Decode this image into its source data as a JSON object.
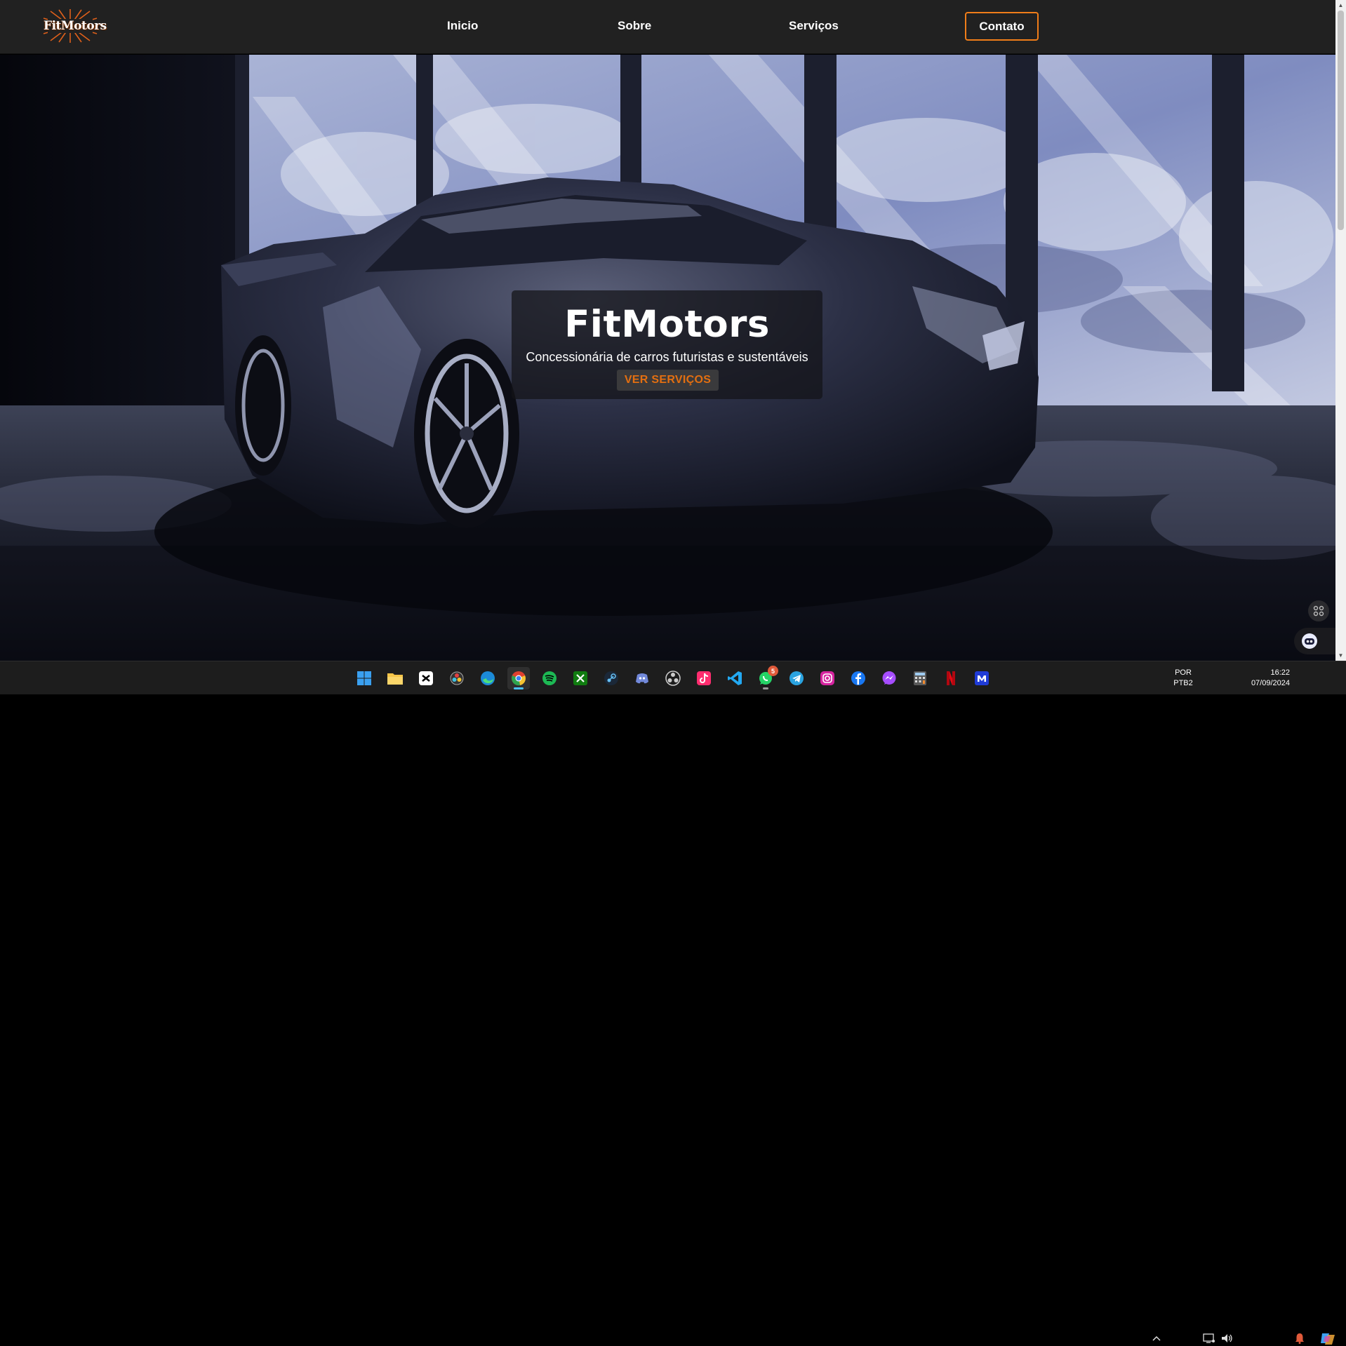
{
  "header": {
    "logo_text": "FitMotors",
    "nav": [
      "Inicio",
      "Sobre",
      "Serviços"
    ],
    "contact_label": "Contato",
    "accent_color": "#f07d19"
  },
  "hero": {
    "title": "FitMotors",
    "subtitle": "Concessionária de carros futuristas e sustentáveis",
    "button_label": "VER SERVIÇOS",
    "button_color": "#e46f10"
  },
  "taskbar": {
    "apps": [
      {
        "name": "windows-start-icon"
      },
      {
        "name": "file-explorer-icon"
      },
      {
        "name": "capcut-icon"
      },
      {
        "name": "davinci-resolve-icon"
      },
      {
        "name": "edge-icon"
      },
      {
        "name": "chrome-icon",
        "active": true
      },
      {
        "name": "spotify-icon"
      },
      {
        "name": "xbox-icon"
      },
      {
        "name": "steam-icon"
      },
      {
        "name": "discord-icon"
      },
      {
        "name": "obs-icon"
      },
      {
        "name": "tiktok-icon"
      },
      {
        "name": "vscode-icon"
      },
      {
        "name": "whatsapp-icon",
        "badge": "5"
      },
      {
        "name": "telegram-icon"
      },
      {
        "name": "instagram-icon"
      },
      {
        "name": "facebook-icon"
      },
      {
        "name": "messenger-icon"
      },
      {
        "name": "calculator-icon"
      },
      {
        "name": "netflix-icon"
      },
      {
        "name": "m-app-icon"
      }
    ],
    "language_line1": "POR",
    "language_line2": "PTB2",
    "time": "16:22",
    "date": "07/09/2024"
  }
}
